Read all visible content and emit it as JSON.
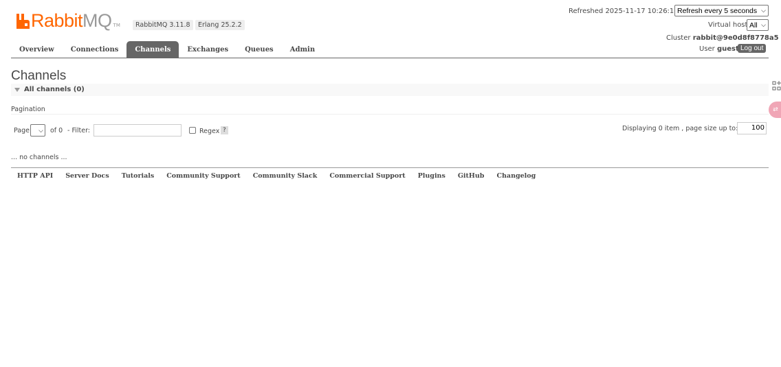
{
  "header": {
    "logo_rabbit": "Rabbit",
    "logo_mq": "MQ",
    "logo_tm": "TM",
    "rabbitmq_version": "RabbitMQ 3.11.8",
    "erlang_version": "Erlang 25.2.2",
    "refreshed_label": "Refreshed 2025-11-17 10:26:16",
    "refresh_select": "Refresh every 5 seconds",
    "virtual_host_label": "Virtual host",
    "virtual_host_select": "All",
    "cluster_label": "Cluster",
    "cluster_name": "rabbit@9e0d8f8778a5",
    "user_label": "User",
    "user_name": "guest",
    "logout_label": "Log out"
  },
  "tabs": [
    {
      "label": "Overview",
      "active": false
    },
    {
      "label": "Connections",
      "active": false
    },
    {
      "label": "Channels",
      "active": true
    },
    {
      "label": "Exchanges",
      "active": false
    },
    {
      "label": "Queues",
      "active": false
    },
    {
      "label": "Admin",
      "active": false
    }
  ],
  "main": {
    "title": "Channels",
    "section_label": "All channels (0)",
    "pagination_label": "Pagination",
    "page_label": "Page",
    "page_value": "",
    "of_label": "of 0",
    "filter_label": "- Filter:",
    "filter_value": "",
    "regex_label": "Regex",
    "help_label": "?",
    "displaying_label": "Displaying 0 item , page size up to:",
    "page_size": "100",
    "empty_message": "... no channels ..."
  },
  "footer": {
    "links": [
      "HTTP API",
      "Server Docs",
      "Tutorials",
      "Community Support",
      "Community Slack",
      "Commercial Support",
      "Plugins",
      "GitHub",
      "Changelog"
    ]
  },
  "colors": {
    "brand_orange": "#ff6600",
    "tab_active_bg": "#666666",
    "text": "#484848"
  },
  "icons": {
    "logo": "rabbitmq-logo-icon",
    "dropdown": "chevron-down-icon",
    "section_toggle": "triangle-down-icon",
    "edge_widget_1": "grid-plus-icon",
    "edge_widget_2": "translate-icon"
  }
}
